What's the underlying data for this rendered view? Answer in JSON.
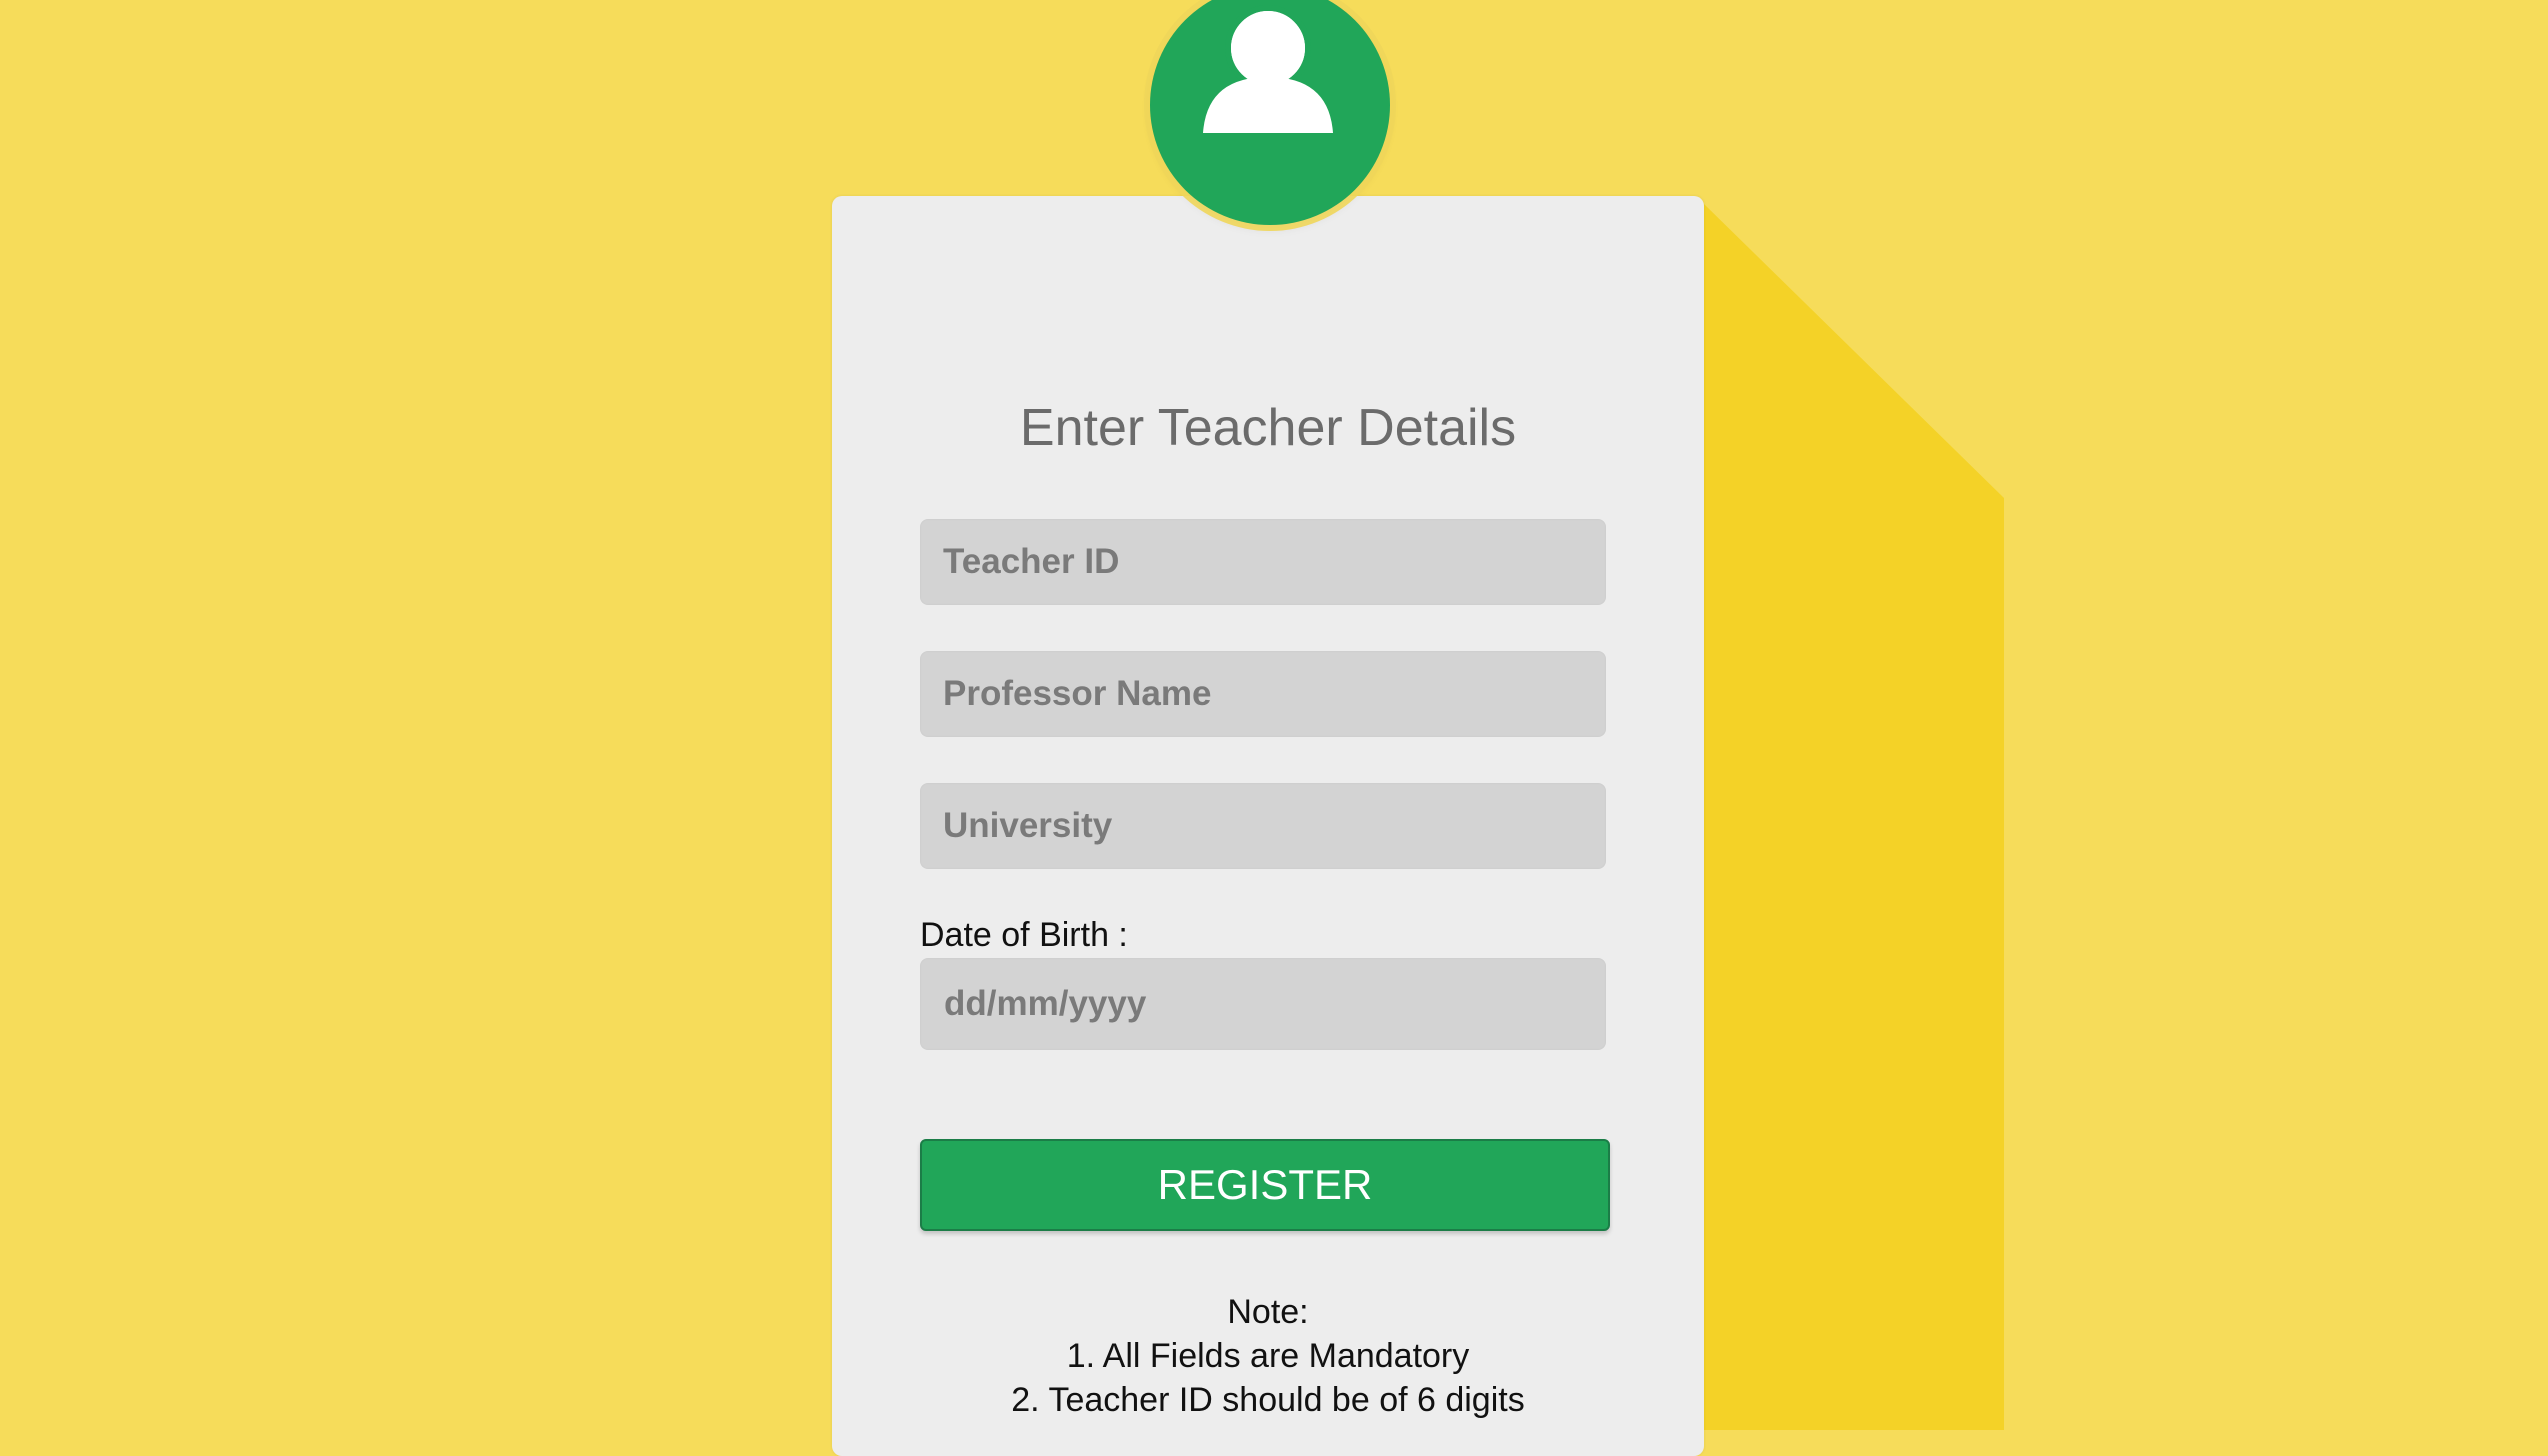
{
  "form": {
    "title": "Enter Teacher Details",
    "teacher_id_placeholder": "Teacher ID",
    "professor_name_placeholder": "Professor Name",
    "university_placeholder": "University",
    "dob_label": "Date of Birth :",
    "dob_placeholder": "dd/mm/yyyy",
    "register_label": "REGISTER"
  },
  "note": {
    "heading": "Note:",
    "line1": "1. All Fields are Mandatory",
    "line2": "2. Teacher ID should be of 6 digits"
  },
  "colors": {
    "background": "#f6dc5a",
    "shadow": "#f4d227",
    "card": "#ededed",
    "accent": "#21a659",
    "field": "#d3d3d3"
  },
  "icons": {
    "avatar": "user-icon"
  }
}
